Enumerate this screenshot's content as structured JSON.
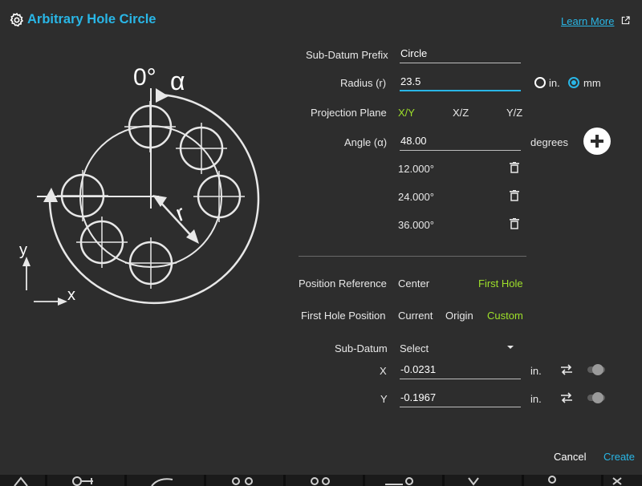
{
  "dialog": {
    "title": "Arbitrary Hole Circle",
    "learn_more": "Learn More"
  },
  "diagram": {
    "zero_label": "0°",
    "alpha_label": "α",
    "radius_label": "r",
    "y_label": "y",
    "x_label": "x"
  },
  "form": {
    "sub_datum_prefix": {
      "label": "Sub-Datum Prefix",
      "value": "Circle"
    },
    "radius": {
      "label": "Radius (r)",
      "value": "23.5",
      "units": [
        {
          "label": "in.",
          "selected": false
        },
        {
          "label": "mm",
          "selected": true
        }
      ]
    },
    "projection_plane": {
      "label": "Projection Plane",
      "options": [
        "X/Y",
        "X/Z",
        "Y/Z"
      ],
      "selected": "X/Y"
    },
    "angle": {
      "label": "Angle (α)",
      "value": "48.00",
      "unit": "degrees",
      "entries": [
        "12.000°",
        "24.000°",
        "36.000°"
      ]
    },
    "position_reference": {
      "label": "Position Reference",
      "options": [
        "Center",
        "First Hole"
      ],
      "selected": "First Hole"
    },
    "first_hole_position": {
      "label": "First Hole Position",
      "options": [
        "Current",
        "Origin",
        "Custom"
      ],
      "selected": "Custom"
    },
    "sub_datum": {
      "label": "Sub-Datum",
      "value": "Select"
    },
    "x": {
      "label": "X",
      "value": "-0.0231",
      "unit": "in."
    },
    "y": {
      "label": "Y",
      "value": "-0.1967",
      "unit": "in."
    }
  },
  "actions": {
    "cancel": "Cancel",
    "create": "Create"
  },
  "colors": {
    "accent": "#29b6e6",
    "selected": "#9ee02a",
    "background": "#2d2d2d"
  },
  "icons": [
    "gear-icon",
    "external-link-icon",
    "plus-icon",
    "trash-icon",
    "swap-icon",
    "chevron-down-icon"
  ]
}
